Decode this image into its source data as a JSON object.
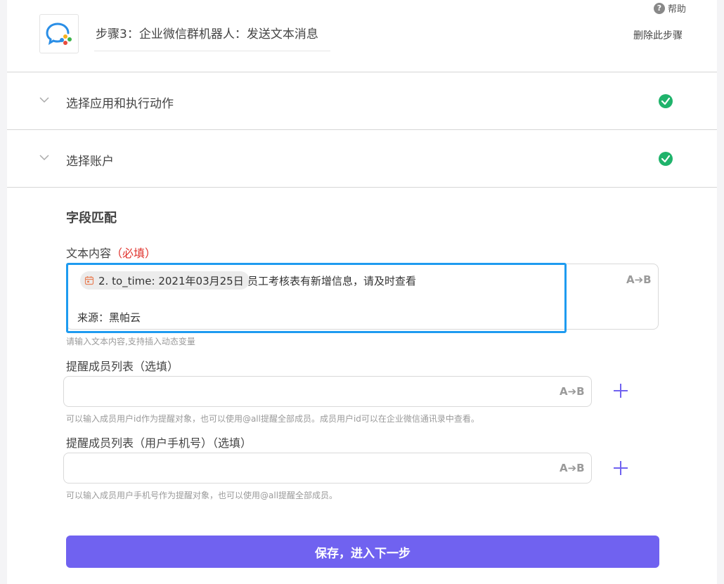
{
  "header": {
    "step_title": "步骤3：企业微信群机器人：发送文本消息",
    "help_label": "帮助",
    "help_icon": "question-circle-icon",
    "delete_step_label": "删除此步骤"
  },
  "sections": [
    {
      "label": "选择应用和执行动作",
      "status": "complete"
    },
    {
      "label": "选择账户",
      "status": "complete"
    }
  ],
  "field_mapping": {
    "title": "字段匹配",
    "text_content": {
      "label": "文本内容",
      "required_mark": "（必填）",
      "chip_text": "2. to_time: 2021年03月25日",
      "chip_icon": "calendar-icon",
      "after_chip_text": "员工考核表有新增信息，请及时查看",
      "source_line": "来源：黑帕云",
      "hint": "请输入文本内容,支持插入动态变量",
      "ab_label": "A➔B"
    },
    "mention_list": {
      "label": "提醒成员列表（选填）",
      "value": "",
      "hint": "可以输入成员用户id作为提醒对象，也可以使用@all提醒全部成员。成员用户id可以在企业微信通讯录中查看。",
      "ab_label": "A➔B"
    },
    "mention_mobile_list": {
      "label": "提醒成员列表（用户手机号）（选填）",
      "value": "",
      "hint": "可以输入成员用户手机号作为提醒对象，也可以使用@all提醒全部成员。",
      "ab_label": "A➔B"
    }
  },
  "save_button_label": "保存，进入下一步",
  "colors": {
    "accent": "#7062f0",
    "focus_border": "#1e9bf0",
    "success": "#1fb36b",
    "required": "#e0332d"
  }
}
